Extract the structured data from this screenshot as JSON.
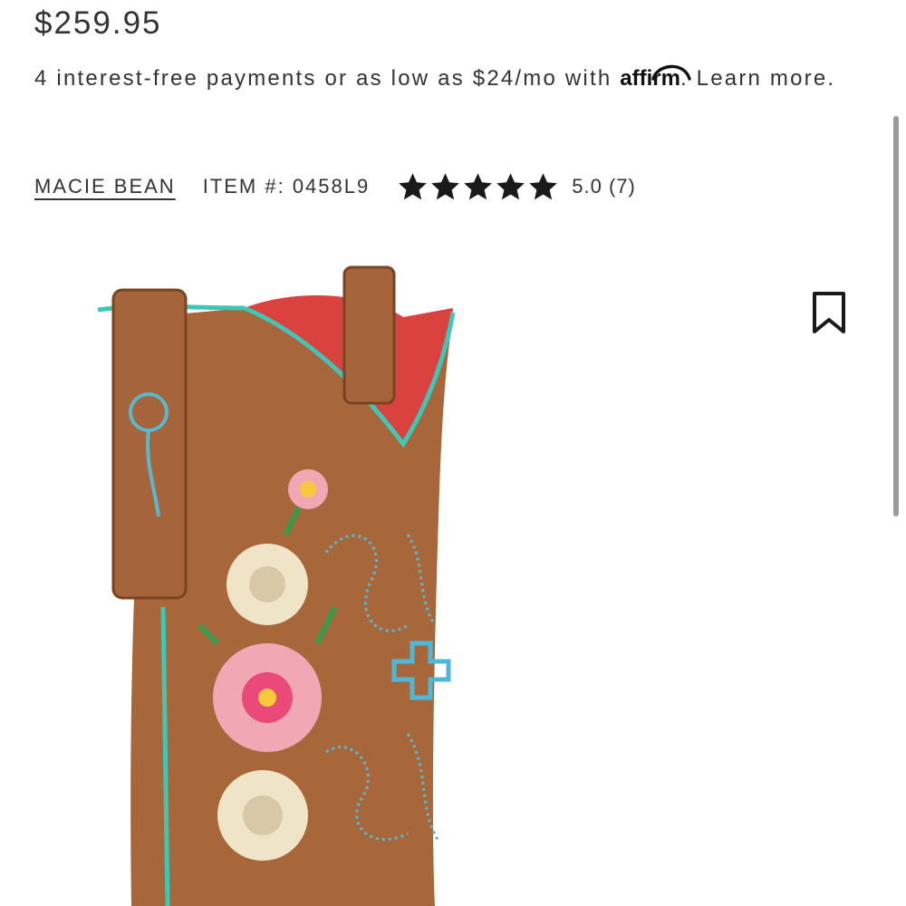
{
  "product": {
    "price": "$259.95",
    "brand": "MACIE BEAN",
    "item_number": "ITEM #: 0458L9",
    "rating_value": 5.0,
    "rating_text": "5.0 (7)",
    "stars": 5,
    "image": "embroidered-floral-cowboy-boot"
  },
  "financing": {
    "text_before": "4 interest-free payments or as low as $24/mo with ",
    "logo_text": "affirm",
    "text_after": ". Learn more."
  },
  "icons": {
    "bookmark": "bookmark-icon",
    "star": "star-icon"
  },
  "colors": {
    "text": "#333333",
    "boot_leather": "#a8673a",
    "boot_trim": "#3ec7b4",
    "boot_lining": "#e0444a"
  }
}
